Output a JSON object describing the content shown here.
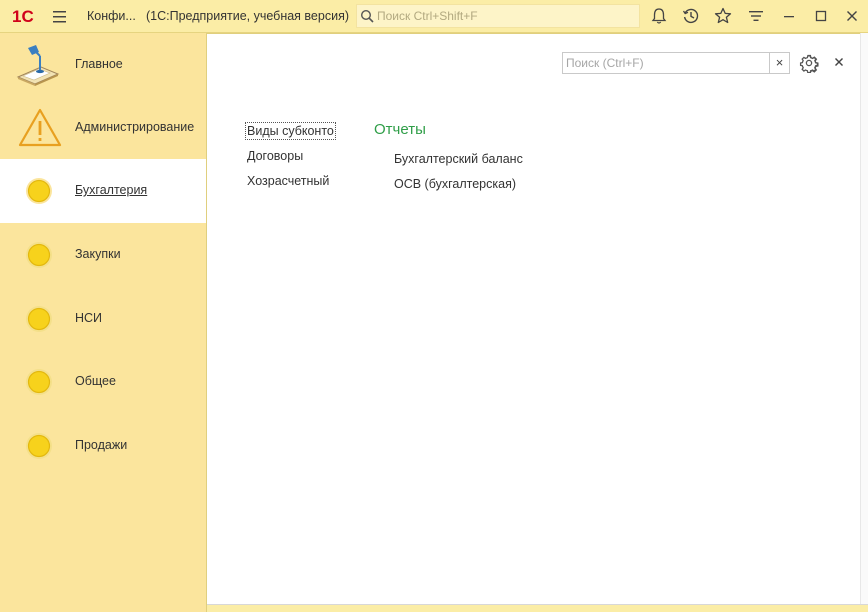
{
  "titlebar": {
    "logo_text": "1С",
    "title": "Конфи...",
    "subtitle": "(1С:Предприятие, учебная версия)",
    "search_placeholder": "Поиск Ctrl+Shift+F",
    "icons": [
      "notifications-icon",
      "history-icon",
      "favorites-icon",
      "menu-icon",
      "minimize-icon",
      "maximize-icon",
      "close-icon"
    ]
  },
  "sidebar": {
    "items": [
      {
        "label": "Главное",
        "icon": "desk-lamp-icon",
        "active": false
      },
      {
        "label": "Администрирование",
        "icon": "warning-triangle-icon",
        "active": false
      },
      {
        "label": "Бухгалтерия",
        "icon": "yellow-circle-icon",
        "active": true
      },
      {
        "label": "Закупки",
        "icon": "yellow-circle-icon",
        "active": false
      },
      {
        "label": "НСИ",
        "icon": "yellow-circle-icon",
        "active": false
      },
      {
        "label": "Общее",
        "icon": "yellow-circle-icon",
        "active": false
      },
      {
        "label": "Продажи",
        "icon": "yellow-circle-icon",
        "active": false
      }
    ]
  },
  "main": {
    "search_placeholder": "Поиск (Ctrl+F)",
    "clear_label": "×",
    "close_label": "×",
    "catalogs": [
      "Виды субконто",
      "Договоры",
      "Хозрасчетный"
    ],
    "reports_heading": "Отчеты",
    "reports": [
      "Бухгалтерский баланс",
      "ОСВ (бухгалтерская)"
    ]
  },
  "colors": {
    "titlebar_bg": "#fbeda6",
    "sidebar_bg": "#fbe59d",
    "accent_red": "#d0021b",
    "heading_green": "#2f9e48",
    "section_icon_yellow": "#f7d21c"
  }
}
